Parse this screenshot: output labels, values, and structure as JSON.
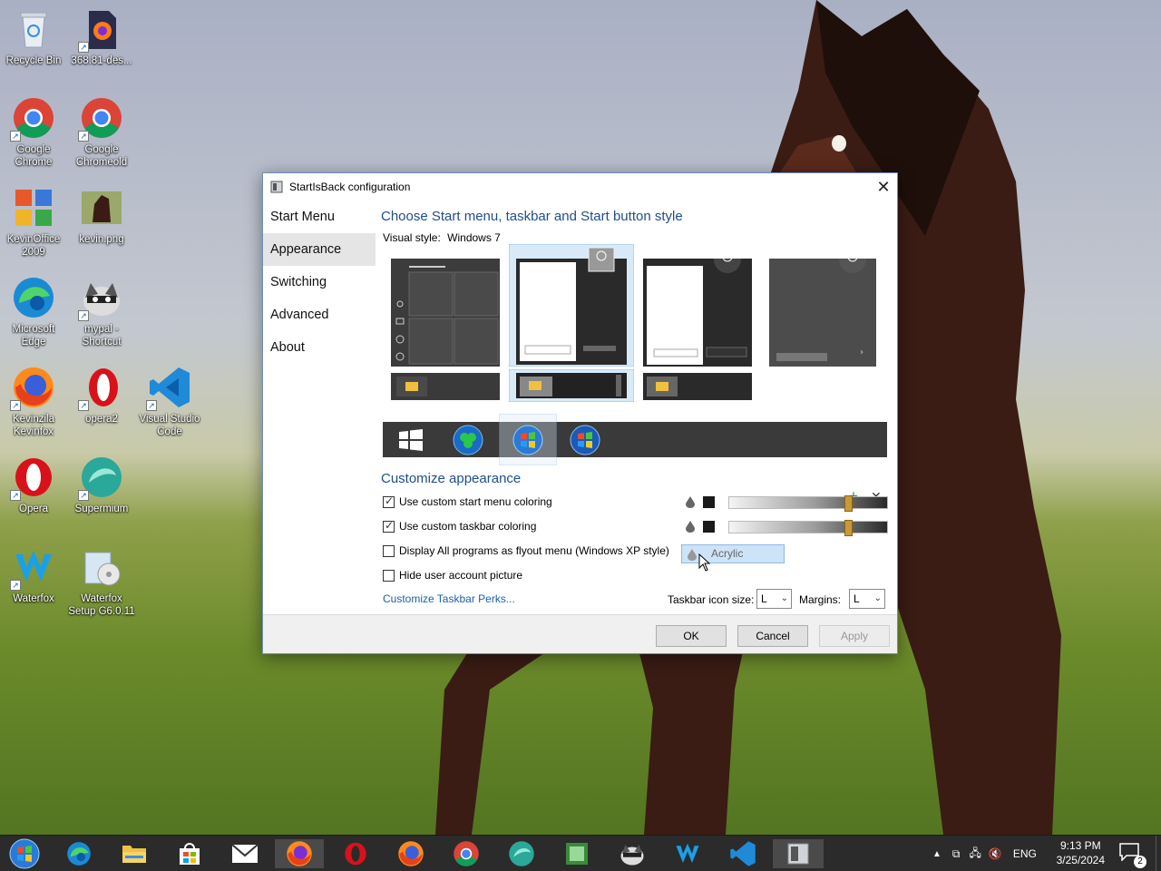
{
  "desktop": {
    "icons": [
      {
        "label": "Recycle Bin",
        "icon": "recycle-bin-icon"
      },
      {
        "label": "368.81-des...",
        "icon": "firefox-installer-icon"
      },
      {
        "label": "Google Chrome",
        "icon": "chrome-icon"
      },
      {
        "label": "Google Chromeold",
        "icon": "chrome-icon"
      },
      {
        "label": "KevinOffice 2009",
        "icon": "office-icon"
      },
      {
        "label": "kevin.png",
        "icon": "image-file-icon"
      },
      {
        "label": "Microsoft Edge",
        "icon": "edge-icon"
      },
      {
        "label": "mypal - Shortcut",
        "icon": "mypal-icon"
      },
      {
        "label": "Kevinzila Kevinfox",
        "icon": "firefox-icon"
      },
      {
        "label": "opera2",
        "icon": "opera-icon"
      },
      {
        "label": "Visual Studio Code",
        "icon": "vscode-icon"
      },
      {
        "label": "Opera",
        "icon": "opera-icon"
      },
      {
        "label": "Supermium",
        "icon": "supermium-icon"
      },
      {
        "label": "Waterfox",
        "icon": "waterfox-icon"
      },
      {
        "label": "Waterfox Setup G6.0.11",
        "icon": "installer-icon"
      }
    ]
  },
  "dialog": {
    "title": "StartIsBack configuration",
    "nav": [
      {
        "label": "Start Menu"
      },
      {
        "label": "Appearance"
      },
      {
        "label": "Switching"
      },
      {
        "label": "Advanced"
      },
      {
        "label": "About"
      }
    ],
    "active_nav": "Appearance",
    "heading": "Choose Start menu, taskbar and Start button style",
    "visual_style_label": "Visual style:",
    "visual_style_value": "Windows 7",
    "customize_heading": "Customize appearance",
    "checkboxes": [
      {
        "label": "Use custom start menu coloring",
        "checked": true
      },
      {
        "label": "Use custom taskbar coloring",
        "checked": true
      },
      {
        "label": "Display All programs as flyout menu (Windows XP style)",
        "checked": false
      },
      {
        "label": "Hide user account picture",
        "checked": false
      }
    ],
    "link": "Customize Taskbar Perks...",
    "acrylic_label": "Acrylic",
    "taskbar_icon_size_label": "Taskbar icon size:",
    "taskbar_icon_size_value": "L",
    "margins_label": "Margins:",
    "margins_value": "L",
    "buttons": {
      "ok": "OK",
      "cancel": "Cancel",
      "apply": "Apply"
    }
  },
  "taskbar": {
    "tray_lang": "ENG",
    "time": "9:13 PM",
    "date": "3/25/2024",
    "notification_count": "2"
  },
  "colors": {
    "accent": "#1f4e8c",
    "link": "#1a5fb0",
    "slider_knob": "#c89a36"
  }
}
